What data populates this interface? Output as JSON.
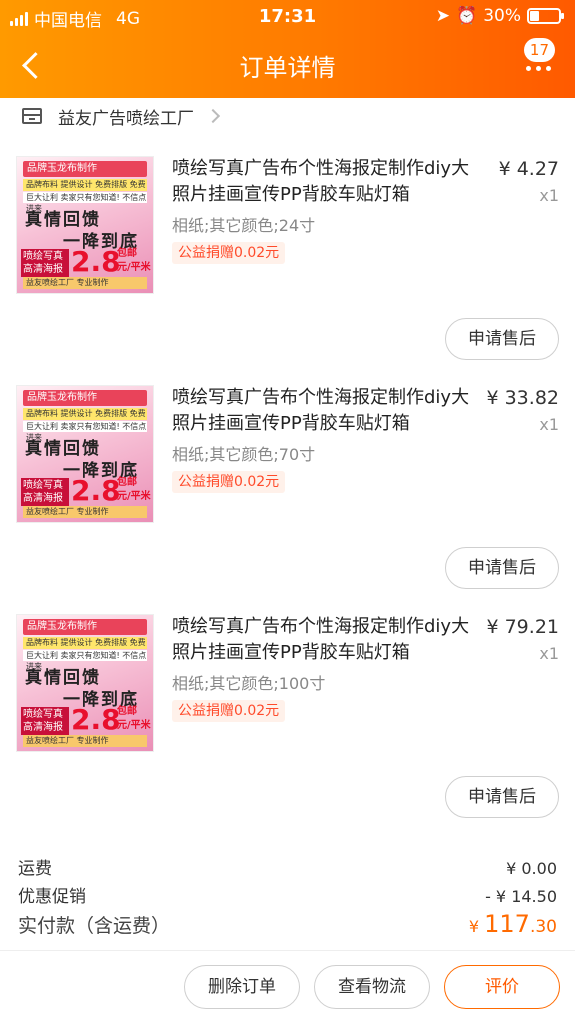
{
  "status_bar": {
    "carrier": "中国电信",
    "network": "4G",
    "time": "17:31",
    "battery": "30%"
  },
  "navbar": {
    "title": "订单详情",
    "badge_count": "17",
    "back_icon": "chevron-left-icon",
    "more_icon": "more-dots-icon"
  },
  "shop": {
    "name": "益友广告喷绘工厂"
  },
  "items": [
    {
      "title": "喷绘写真广告布个性海报定制作diy大照片挂画宣传PP背胶车贴灯箱",
      "price": "¥ 4.27",
      "qty": "x1",
      "spec": "相纸;其它颜色;24寸",
      "charity": "公益捐赠0.02元",
      "after_sale": "申请售后"
    },
    {
      "title": "喷绘写真广告布个性海报定制作diy大照片挂画宣传PP背胶车贴灯箱",
      "price": "¥ 33.82",
      "qty": "x1",
      "spec": "相纸;其它颜色;70寸",
      "charity": "公益捐赠0.02元",
      "after_sale": "申请售后"
    },
    {
      "title": "喷绘写真广告布个性海报定制作diy大照片挂画宣传PP背胶车贴灯箱",
      "price": "¥ 79.21",
      "qty": "x1",
      "spec": "相纸;其它颜色;100寸",
      "charity": "公益捐赠0.02元",
      "after_sale": "申请售后"
    }
  ],
  "thumbnail": {
    "top_text": "品牌玉龙布制作",
    "band1": "品牌布料 提供设计 免费排版 免费留白",
    "band2": "巨大让利 卖家只有您知道! 不信点进来",
    "calli1": "真情回馈",
    "calli2": "一降到底",
    "left_text": "喷绘写真 高清海报",
    "price": "2.8",
    "unit": "包邮 元/平米",
    "bottom_text": "益友喷绘工厂 专业制作"
  },
  "summary": {
    "shipping_label": "运费",
    "shipping_value": "¥ 0.00",
    "discount_label": "优惠促销",
    "discount_value": "- ¥ 14.50",
    "total_label": "实付款（含运费）",
    "total_currency": "¥",
    "total_int": "117",
    "total_dec": ".30"
  },
  "actions": {
    "delete": "删除订单",
    "logistics": "查看物流",
    "review": "评价"
  },
  "colors": {
    "accent": "#ff6a00",
    "charity_text": "#ff4b2b"
  }
}
